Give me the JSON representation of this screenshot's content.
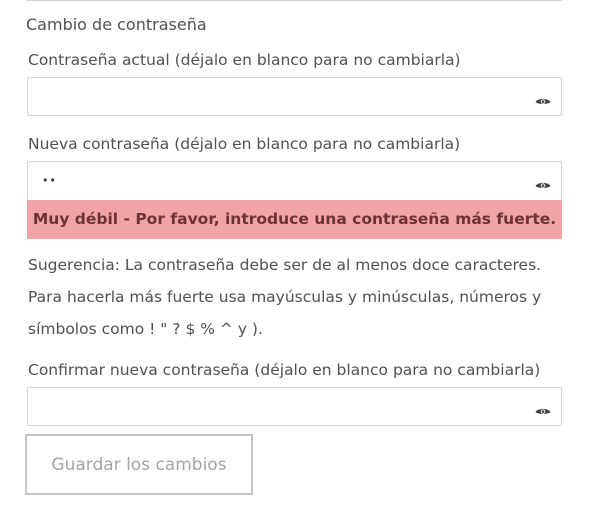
{
  "fieldset": {
    "legend": "Cambio de contraseña"
  },
  "current_password": {
    "label": "Contraseña actual (déjalo en blanco para no cambiarla)",
    "value": ""
  },
  "new_password": {
    "label": "Nueva contraseña (déjalo en blanco para no cambiarla)",
    "value": "••"
  },
  "strength_meter": {
    "text": "Muy débil - Por favor, introduce una contraseña más fuerte.",
    "color": "#f1a4a7"
  },
  "hint": {
    "text": "Sugerencia: La contraseña debe ser de al menos doce caracteres. Para hacerla más fuerte usa mayúsculas y minúsculas, números y símbolos como ! \" ? $ % ^ y )."
  },
  "confirm_password": {
    "label": "Confirmar nueva contraseña (déjalo en blanco para no cambiarla)",
    "value": ""
  },
  "actions": {
    "save_label": "Guardar los cambios"
  },
  "icons": {
    "show_password": "eye-icon"
  }
}
